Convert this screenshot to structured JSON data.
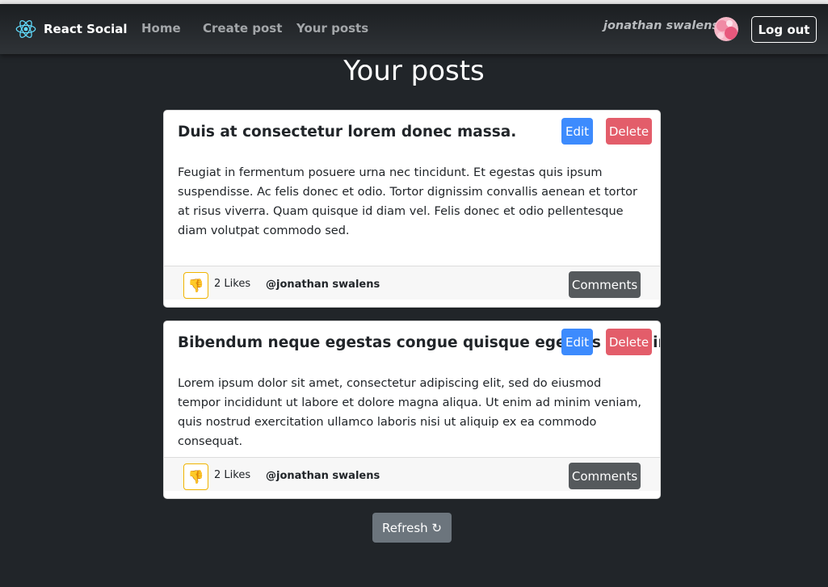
{
  "nav": {
    "brand": "React Social",
    "links": [
      "Home",
      "Create post",
      "Your posts"
    ],
    "user_name": "jonathan swalens",
    "logout_label": "Log out"
  },
  "page": {
    "title": "Your posts"
  },
  "posts": [
    {
      "title": "Duis at consectetur lorem donec massa.",
      "body": "Feugiat in fermentum posuere urna nec tincidunt. Et egestas quis ipsum suspendisse. Ac felis donec et odio. Tortor dignissim convallis aenean et tortor at risus viverra. Quam quisque id diam vel. Felis donec et odio pellentesque diam volutpat commodo sed.",
      "edit_label": "Edit",
      "delete_label": "Delete",
      "likes": "2 Likes",
      "author": "@jonathan swalens",
      "comments_label": "Comments",
      "like_icon": "👎"
    },
    {
      "title": "Bibendum neque egestas congue quisque egestas diam in.",
      "body": "Lorem ipsum dolor sit amet, consectetur adipiscing elit, sed do eiusmod tempor incididunt ut labore et dolore magna aliqua. Ut enim ad minim veniam, quis nostrud exercitation ullamco laboris nisi ut aliquip ex ea commodo consequat.",
      "edit_label": "Edit",
      "delete_label": "Delete",
      "likes": "2 Likes",
      "author": "@jonathan swalens",
      "comments_label": "Comments",
      "like_icon": "👎"
    }
  ],
  "refresh_label": "Refresh ↻",
  "colors": {
    "background": "#212529",
    "primary": "#3d8bfd",
    "danger": "#e35d6a",
    "secondary": "#6c757d",
    "warning": "#f0b400"
  }
}
